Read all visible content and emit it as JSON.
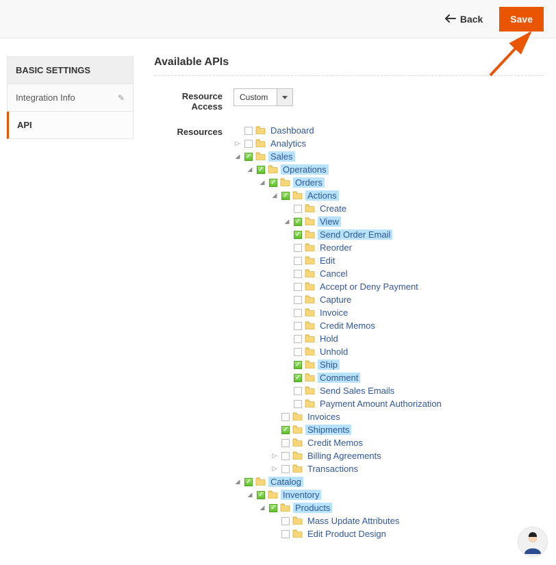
{
  "topbar": {
    "back_label": "Back",
    "save_label": "Save"
  },
  "sidebar": {
    "heading": "BASIC SETTINGS",
    "items": [
      {
        "label": "Integration Info",
        "active": false,
        "editable": true
      },
      {
        "label": "API",
        "active": true,
        "editable": false
      }
    ]
  },
  "content": {
    "section_title": "Available APIs",
    "labels": {
      "resource_access": "Resource Access",
      "resources": "Resources"
    },
    "resource_access_value": "Custom",
    "tree": [
      {
        "label": "Dashboard",
        "checked": false,
        "highlight": false,
        "toggle": "none"
      },
      {
        "label": "Analytics",
        "checked": false,
        "highlight": false,
        "toggle": "closed"
      },
      {
        "label": "Sales",
        "checked": true,
        "highlight": true,
        "toggle": "open",
        "children": [
          {
            "label": "Operations",
            "checked": true,
            "highlight": true,
            "toggle": "open",
            "children": [
              {
                "label": "Orders",
                "checked": true,
                "highlight": true,
                "toggle": "open",
                "children": [
                  {
                    "label": "Actions",
                    "checked": true,
                    "highlight": true,
                    "toggle": "open",
                    "children": [
                      {
                        "label": "Create",
                        "checked": false,
                        "highlight": false,
                        "toggle": "none"
                      },
                      {
                        "label": "View",
                        "checked": true,
                        "highlight": true,
                        "toggle": "open"
                      },
                      {
                        "label": "Send Order Email",
                        "checked": true,
                        "highlight": true,
                        "toggle": "none"
                      },
                      {
                        "label": "Reorder",
                        "checked": false,
                        "highlight": false,
                        "toggle": "none"
                      },
                      {
                        "label": "Edit",
                        "checked": false,
                        "highlight": false,
                        "toggle": "none"
                      },
                      {
                        "label": "Cancel",
                        "checked": false,
                        "highlight": false,
                        "toggle": "none"
                      },
                      {
                        "label": "Accept or Deny Payment",
                        "checked": false,
                        "highlight": false,
                        "toggle": "none"
                      },
                      {
                        "label": "Capture",
                        "checked": false,
                        "highlight": false,
                        "toggle": "none"
                      },
                      {
                        "label": "Invoice",
                        "checked": false,
                        "highlight": false,
                        "toggle": "none"
                      },
                      {
                        "label": "Credit Memos",
                        "checked": false,
                        "highlight": false,
                        "toggle": "none"
                      },
                      {
                        "label": "Hold",
                        "checked": false,
                        "highlight": false,
                        "toggle": "none"
                      },
                      {
                        "label": "Unhold",
                        "checked": false,
                        "highlight": false,
                        "toggle": "none"
                      },
                      {
                        "label": "Ship",
                        "checked": true,
                        "highlight": true,
                        "toggle": "none"
                      },
                      {
                        "label": "Comment",
                        "checked": true,
                        "highlight": true,
                        "toggle": "none"
                      },
                      {
                        "label": "Send Sales Emails",
                        "checked": false,
                        "highlight": false,
                        "toggle": "none"
                      },
                      {
                        "label": "Payment Amount Authorization",
                        "checked": false,
                        "highlight": false,
                        "toggle": "none"
                      }
                    ]
                  },
                  {
                    "label": "Invoices",
                    "checked": false,
                    "highlight": false,
                    "toggle": "none"
                  },
                  {
                    "label": "Shipments",
                    "checked": true,
                    "highlight": true,
                    "toggle": "none"
                  },
                  {
                    "label": "Credit Memos",
                    "checked": false,
                    "highlight": false,
                    "toggle": "none"
                  },
                  {
                    "label": "Billing Agreements",
                    "checked": false,
                    "highlight": false,
                    "toggle": "closed"
                  },
                  {
                    "label": "Transactions",
                    "checked": false,
                    "highlight": false,
                    "toggle": "closed"
                  }
                ]
              }
            ]
          }
        ]
      },
      {
        "label": "Catalog",
        "checked": true,
        "highlight": true,
        "toggle": "open",
        "children": [
          {
            "label": "Inventory",
            "checked": true,
            "highlight": true,
            "toggle": "open",
            "children": [
              {
                "label": "Products",
                "checked": true,
                "highlight": true,
                "toggle": "open",
                "children": [
                  {
                    "label": "Mass Update Attributes",
                    "checked": false,
                    "highlight": false,
                    "toggle": "none"
                  },
                  {
                    "label": "Edit Product Design",
                    "checked": false,
                    "highlight": false,
                    "toggle": "none"
                  }
                ]
              }
            ]
          }
        ]
      }
    ]
  }
}
